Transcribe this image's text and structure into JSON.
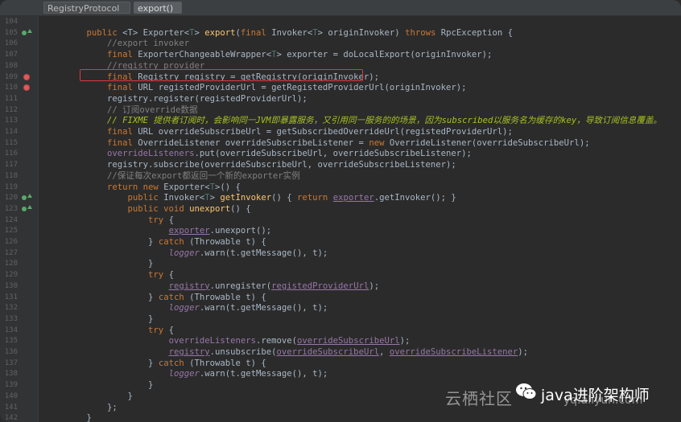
{
  "breadcrumb": {
    "class_name": "RegistryProtocol",
    "method_name": "export()"
  },
  "colors": {
    "keyword": "#cc7832",
    "comment": "#808080",
    "todo": "#a8c023",
    "method": "#ffc66d",
    "field": "#9876aa",
    "highlight_box": "#e0393e",
    "breakpoint": "#db5c5c"
  },
  "lines": [
    {
      "num": "104",
      "marker": "",
      "segments": []
    },
    {
      "num": "105",
      "marker": "override",
      "segments": [
        {
          "t": "    public ",
          "c": "kw"
        },
        {
          "t": "<T> Exporter<"
        },
        {
          "t": "T",
          "c": "gen"
        },
        {
          "t": "> "
        },
        {
          "t": "export",
          "c": "fn"
        },
        {
          "t": "("
        },
        {
          "t": "final ",
          "c": "kw"
        },
        {
          "t": "Invoker<"
        },
        {
          "t": "T",
          "c": "gen"
        },
        {
          "t": "> originInvoker) "
        },
        {
          "t": "throws ",
          "c": "kw"
        },
        {
          "t": "RpcException {"
        }
      ]
    },
    {
      "num": "106",
      "marker": "",
      "segments": [
        {
          "t": "        //export invoker",
          "c": "cm"
        }
      ]
    },
    {
      "num": "107",
      "marker": "",
      "segments": [
        {
          "t": "        final ",
          "c": "kw"
        },
        {
          "t": "ExporterChangeableWrapper<"
        },
        {
          "t": "T",
          "c": "gen"
        },
        {
          "t": "> exporter = doLocalExport(originInvoker);"
        }
      ]
    },
    {
      "num": "108",
      "marker": "",
      "segments": [
        {
          "t": "        //registry provider",
          "c": "cm"
        }
      ]
    },
    {
      "num": "109",
      "marker": "breakpoint",
      "segments": [
        {
          "t": "        final ",
          "c": "kw"
        },
        {
          "t": "Registry registry = getRegistry(originInvoker);"
        }
      ]
    },
    {
      "num": "110",
      "marker": "breakpoint",
      "segments": [
        {
          "t": "        final ",
          "c": "kw"
        },
        {
          "t": "URL registedProviderUrl = getRegistedProviderUrl(originInvoker);"
        }
      ]
    },
    {
      "num": "111",
      "marker": "",
      "segments": [
        {
          "t": "        registry.register(registedProviderUrl);"
        }
      ]
    },
    {
      "num": "112",
      "marker": "",
      "segments": [
        {
          "t": "        // 订阅override数据",
          "c": "cm"
        }
      ]
    },
    {
      "num": "113",
      "marker": "",
      "segments": [
        {
          "t": "        // FIXME 提供者订阅时，会影响同一JVM即暴露服务，又引用同一服务的的场景，因为subscribed以服务名为缓存的key，导致订阅信息覆盖。",
          "c": "todo"
        }
      ]
    },
    {
      "num": "114",
      "marker": "",
      "segments": [
        {
          "t": "        final ",
          "c": "kw"
        },
        {
          "t": "URL overrideSubscribeUrl = getSubscribedOverrideUrl(registedProviderUrl);"
        }
      ]
    },
    {
      "num": "115",
      "marker": "",
      "segments": [
        {
          "t": "        final ",
          "c": "kw"
        },
        {
          "t": "OverrideListener overrideSubscribeListener = "
        },
        {
          "t": "new ",
          "c": "kw"
        },
        {
          "t": "OverrideListener(overrideSubscribeUrl);"
        }
      ]
    },
    {
      "num": "116",
      "marker": "",
      "segments": [
        {
          "t": "        "
        },
        {
          "t": "overrideListeners",
          "c": "fld"
        },
        {
          "t": ".put(overrideSubscribeUrl, overrideSubscribeListener);"
        }
      ]
    },
    {
      "num": "117",
      "marker": "",
      "segments": [
        {
          "t": "        registry.subscribe(overrideSubscribeUrl, overrideSubscribeListener);"
        }
      ]
    },
    {
      "num": "118",
      "marker": "",
      "segments": [
        {
          "t": "        //保证每次export都返回一个新的exporter实例",
          "c": "cm"
        }
      ]
    },
    {
      "num": "119",
      "marker": "",
      "segments": [
        {
          "t": "        return new ",
          "c": "kw"
        },
        {
          "t": "Exporter<"
        },
        {
          "t": "T",
          "c": "gen"
        },
        {
          "t": ">() {"
        }
      ]
    },
    {
      "num": "120",
      "marker": "override",
      "segments": [
        {
          "t": "            public ",
          "c": "kw"
        },
        {
          "t": "Invoker<"
        },
        {
          "t": "T",
          "c": "gen"
        },
        {
          "t": "> "
        },
        {
          "t": "getInvoker",
          "c": "fn"
        },
        {
          "t": "() { "
        },
        {
          "t": "return ",
          "c": "kw"
        },
        {
          "t": "exporter",
          "c": "fldu"
        },
        {
          "t": ".getInvoker(); }"
        }
      ]
    },
    {
      "num": "123",
      "marker": "override",
      "segments": [
        {
          "t": "            public void ",
          "c": "kw"
        },
        {
          "t": "unexport",
          "c": "fn"
        },
        {
          "t": "() {"
        }
      ]
    },
    {
      "num": "124",
      "marker": "",
      "segments": [
        {
          "t": "                try ",
          "c": "kw"
        },
        {
          "t": "{"
        }
      ]
    },
    {
      "num": "125",
      "marker": "",
      "segments": [
        {
          "t": "                    "
        },
        {
          "t": "exporter",
          "c": "fldu"
        },
        {
          "t": ".unexport();"
        }
      ]
    },
    {
      "num": "126",
      "marker": "",
      "segments": [
        {
          "t": "                } "
        },
        {
          "t": "catch ",
          "c": "kw"
        },
        {
          "t": "(Throwable t) {"
        }
      ]
    },
    {
      "num": "127",
      "marker": "",
      "segments": [
        {
          "t": "                    "
        },
        {
          "t": "logger",
          "c": "stat"
        },
        {
          "t": ".warn(t.getMessage(), t);"
        }
      ]
    },
    {
      "num": "128",
      "marker": "",
      "segments": [
        {
          "t": "                }"
        }
      ]
    },
    {
      "num": "129",
      "marker": "",
      "segments": [
        {
          "t": "                try ",
          "c": "kw"
        },
        {
          "t": "{"
        }
      ]
    },
    {
      "num": "130",
      "marker": "",
      "segments": [
        {
          "t": "                    "
        },
        {
          "t": "registry",
          "c": "fldu"
        },
        {
          "t": ".unregister("
        },
        {
          "t": "registedProviderUrl",
          "c": "fldu"
        },
        {
          "t": ");"
        }
      ]
    },
    {
      "num": "131",
      "marker": "",
      "segments": [
        {
          "t": "                } "
        },
        {
          "t": "catch ",
          "c": "kw"
        },
        {
          "t": "(Throwable t) {"
        }
      ]
    },
    {
      "num": "132",
      "marker": "",
      "segments": [
        {
          "t": "                    "
        },
        {
          "t": "logger",
          "c": "stat"
        },
        {
          "t": ".warn(t.getMessage(), t);"
        }
      ]
    },
    {
      "num": "133",
      "marker": "",
      "segments": [
        {
          "t": "                }"
        }
      ]
    },
    {
      "num": "134",
      "marker": "",
      "segments": [
        {
          "t": "                try ",
          "c": "kw"
        },
        {
          "t": "{"
        }
      ]
    },
    {
      "num": "135",
      "marker": "",
      "segments": [
        {
          "t": "                    "
        },
        {
          "t": "overrideListeners",
          "c": "fld"
        },
        {
          "t": ".remove("
        },
        {
          "t": "overrideSubscribeUrl",
          "c": "fldu"
        },
        {
          "t": ");"
        }
      ]
    },
    {
      "num": "136",
      "marker": "",
      "segments": [
        {
          "t": "                    "
        },
        {
          "t": "registry",
          "c": "fldu"
        },
        {
          "t": ".unsubscribe("
        },
        {
          "t": "overrideSubscribeUrl",
          "c": "fldu"
        },
        {
          "t": ", "
        },
        {
          "t": "overrideSubscribeListener",
          "c": "fldu"
        },
        {
          "t": ");"
        }
      ]
    },
    {
      "num": "137",
      "marker": "",
      "segments": [
        {
          "t": "                } "
        },
        {
          "t": "catch ",
          "c": "kw"
        },
        {
          "t": "(Throwable t) {"
        }
      ]
    },
    {
      "num": "138",
      "marker": "",
      "segments": [
        {
          "t": "                    "
        },
        {
          "t": "logger",
          "c": "stat"
        },
        {
          "t": ".warn(t.getMessage(), t);"
        }
      ]
    },
    {
      "num": "139",
      "marker": "",
      "segments": [
        {
          "t": "                }"
        }
      ]
    },
    {
      "num": "140",
      "marker": "",
      "segments": [
        {
          "t": "            }"
        }
      ]
    },
    {
      "num": "141",
      "marker": "",
      "segments": [
        {
          "t": "        };"
        }
      ]
    },
    {
      "num": "142",
      "marker": "",
      "segments": [
        {
          "t": "    }"
        }
      ]
    }
  ],
  "watermark": {
    "site": "云栖社区",
    "url": "yq.aliyun.com",
    "handle": "java进阶架构师"
  }
}
